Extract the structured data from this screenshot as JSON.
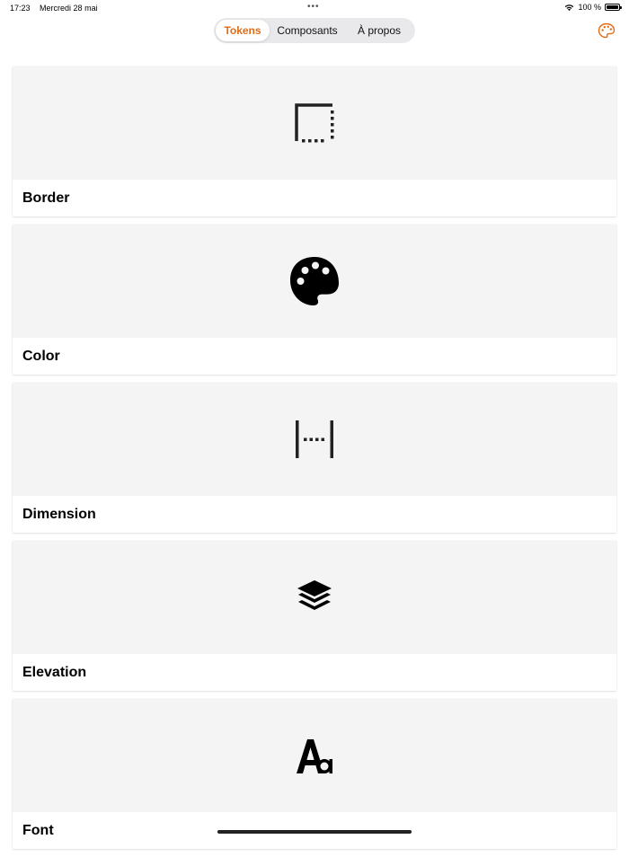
{
  "status_bar": {
    "time": "17:23",
    "date": "Mercredi 28 mai",
    "multitask_dots": "•••",
    "battery_text": "100 %",
    "icons": [
      "wifi-icon",
      "battery-icon"
    ]
  },
  "segmented_control": {
    "items": [
      {
        "label": "Tokens",
        "selected": true
      },
      {
        "label": "Composants",
        "selected": false
      },
      {
        "label": "À propos",
        "selected": false
      }
    ]
  },
  "header": {
    "right_icon": "palette-icon"
  },
  "cards": [
    {
      "title": "Border",
      "icon": "border-icon"
    },
    {
      "title": "Color",
      "icon": "palette-icon"
    },
    {
      "title": "Dimension",
      "icon": "dimension-icon"
    },
    {
      "title": "Elevation",
      "icon": "layers-icon"
    },
    {
      "title": "Font",
      "icon": "font-icon"
    }
  ],
  "colors": {
    "accent": "#e46a14",
    "card_media_bg": "#f4f4f4",
    "segmented_bg": "#e9e9ec"
  }
}
